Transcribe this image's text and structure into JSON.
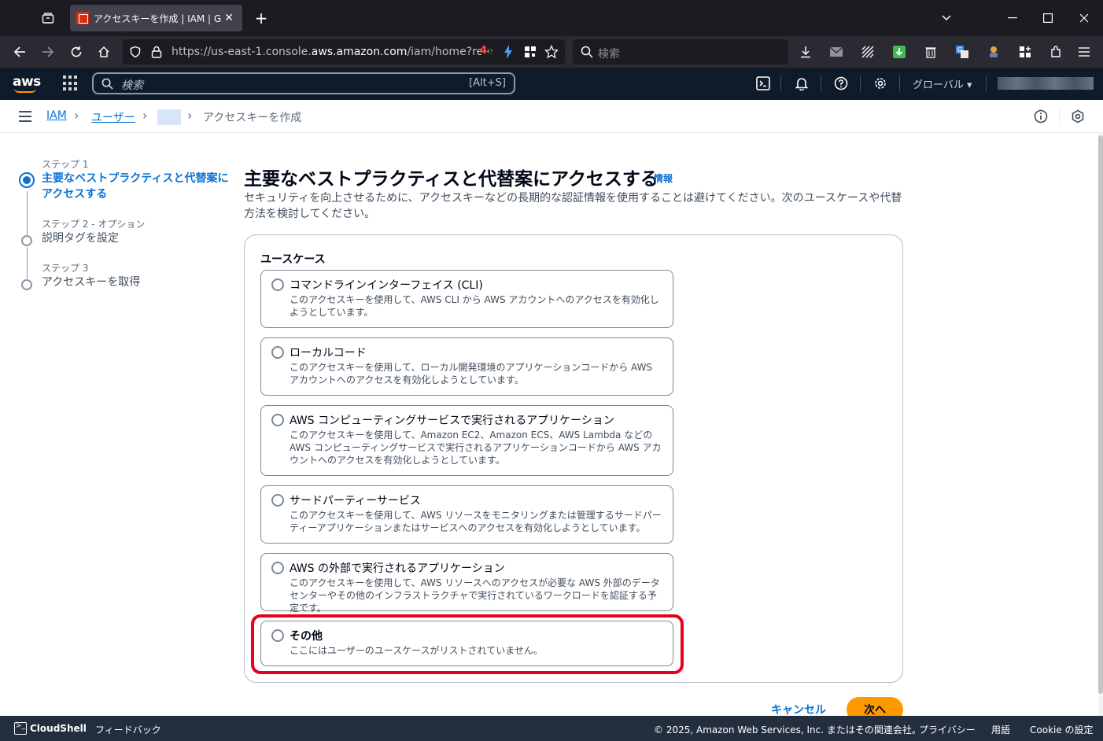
{
  "browser": {
    "tab_title": "アクセスキーを作成 | IAM | Global",
    "url_prefix": "https://us-east-1.console.",
    "url_domain": "aws.amazon.com",
    "url_suffix": "/iam/home?region=u",
    "search_placeholder": "検索"
  },
  "aws_nav": {
    "logo": "aws",
    "search_placeholder": "検索",
    "search_shortcut": "[Alt+S]",
    "region": "グローバル ▾"
  },
  "breadcrumb": {
    "iam": "IAM",
    "users": "ユーザー",
    "current": "アクセスキーを作成"
  },
  "steps": [
    {
      "num": "ステップ 1",
      "title": "主要なベストプラクティスと代替案にアクセスする",
      "active": true
    },
    {
      "num": "ステップ 2 - オプション",
      "title": "説明タグを設定",
      "active": false
    },
    {
      "num": "ステップ 3",
      "title": "アクセスキーを取得",
      "active": false
    }
  ],
  "page": {
    "title": "主要なベストプラクティスと代替案にアクセスする",
    "info": "情報",
    "description": "セキュリティを向上させるために、アクセスキーなどの長期的な認証情報を使用することは避けてください。次のユースケースや代替方法を検討してください。"
  },
  "usecase": {
    "label": "ユースケース",
    "options": [
      {
        "title": "コマンドラインインターフェイス (CLI)",
        "desc": "このアクセスキーを使用して、AWS CLI から AWS アカウントへのアクセスを有効化しようとしています。"
      },
      {
        "title": "ローカルコード",
        "desc": "このアクセスキーを使用して、ローカル開発環境のアプリケーションコードから AWS アカウントへのアクセスを有効化しようとしています。"
      },
      {
        "title": "AWS コンピューティングサービスで実行されるアプリケーション",
        "desc": "このアクセスキーを使用して、Amazon EC2、Amazon ECS、AWS Lambda などの AWS コンピューティングサービスで実行されるアプリケーションコードから AWS アカウントへのアクセスを有効化しようとしています。"
      },
      {
        "title": "サードパーティーサービス",
        "desc": "このアクセスキーを使用して、AWS リソースをモニタリングまたは管理するサードパーティーアプリケーションまたはサービスへのアクセスを有効化しようとしています。"
      },
      {
        "title": "AWS の外部で実行されるアプリケーション",
        "desc": "このアクセスキーを使用して、AWS リソースへのアクセスが必要な AWS 外部のデータセンターやその他のインフラストラクチャで実行されているワークロードを認証する予定です。"
      },
      {
        "title": "その他",
        "desc": "ここにはユーザーのユースケースがリストされていません。"
      }
    ]
  },
  "actions": {
    "cancel": "キャンセル",
    "next": "次へ"
  },
  "footer": {
    "cloudshell": "CloudShell",
    "feedback": "フィードバック",
    "copyright": "© 2025, Amazon Web Services, Inc. またはその関連会社。",
    "privacy": "プライバシー",
    "terms": "用語",
    "cookie": "Cookie の設定"
  },
  "colors": {
    "accent": "#0972d3",
    "primary_button": "#ff9900",
    "highlight": "#e8001c"
  }
}
